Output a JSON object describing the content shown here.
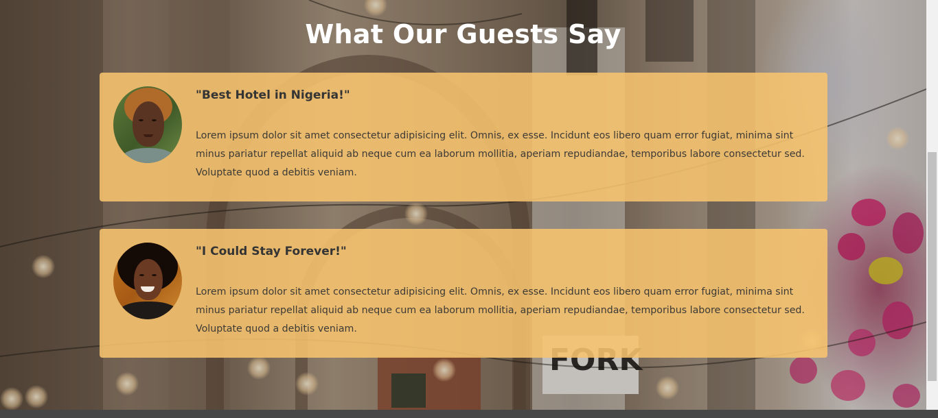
{
  "section": {
    "title": "What Our Guests Say"
  },
  "testimonials": [
    {
      "heading": "\"Best Hotel in Nigeria!\"",
      "text": "Lorem ipsum dolor sit amet consectetur adipisicing elit. Omnis, ex esse. Incidunt eos libero quam error fugiat, minima sint minus pariatur repellat aliquid ab neque cum ea laborum mollitia, aperiam repudiandae, temporibus labore consectetur sed. Voluptate quod a debitis veniam.",
      "avatar": "guest-photo-1"
    },
    {
      "heading": "\"I Could Stay Forever!\"",
      "text": "Lorem ipsum dolor sit amet consectetur adipisicing elit. Omnis, ex esse. Incidunt eos libero quam error fugiat, minima sint minus pariatur repellat aliquid ab neque cum ea laborum mollitia, aperiam repudiandae, temporibus labore consectetur sed. Voluptate quod a debitis veniam.",
      "avatar": "guest-photo-2"
    }
  ],
  "background": {
    "sign_text": "FORK"
  },
  "colors": {
    "card_background": "#f7c46e",
    "title_text": "#ffffff",
    "body_text": "#3d3a36",
    "bottom_bar": "#474747"
  }
}
